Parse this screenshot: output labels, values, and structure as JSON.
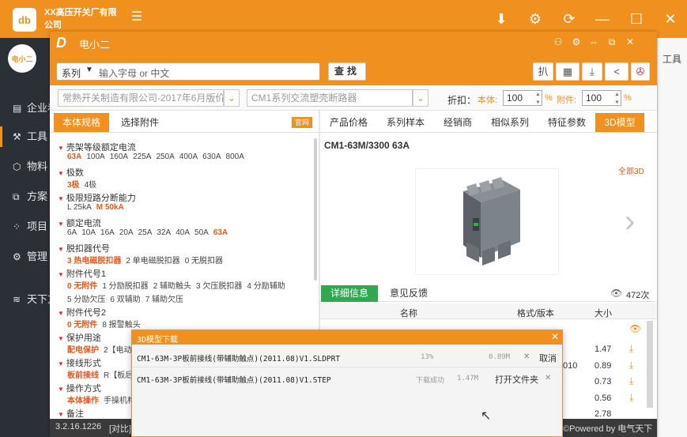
{
  "outer": {
    "logo": "db",
    "company": "XX高压开关厂有限公司",
    "menu_icon": "☰",
    "controls": [
      "⬇",
      "⚙",
      "⟳",
      "—",
      "☐",
      "✕"
    ],
    "sidebar": [
      {
        "icon": "▤",
        "label": "企业看"
      },
      {
        "icon": "⚒",
        "label": "工具"
      },
      {
        "icon": "⬡",
        "label": "物料"
      },
      {
        "icon": "⧉",
        "label": "方案"
      },
      {
        "icon": "⁘",
        "label": "项目"
      },
      {
        "icon": "⚙",
        "label": "管理"
      },
      {
        "icon": "≋",
        "label": "天下方"
      }
    ],
    "right_label": "工具"
  },
  "inner": {
    "app_name": "电小二",
    "logo": "D",
    "controls": [
      "⚇",
      "⚙",
      "⇔",
      "⧉",
      "✕"
    ]
  },
  "search": {
    "type": "系列",
    "placeholder": "输入字母 or 中文",
    "button": "查找",
    "tools": [
      "扒",
      "▦",
      "⤓",
      "<",
      "✇"
    ]
  },
  "filters": {
    "catalog": "常熟开关制造有限公司-2017年6月版价",
    "series": "CM1系列交流塑壳断路器",
    "discount_label": "折扣：",
    "ben_label": "本体:",
    "ben_value": "100",
    "fj_label": "附件:",
    "fj_value": "100",
    "pct": "%"
  },
  "left": {
    "tab_spec": "本体规格",
    "tab_acc": "选择附件",
    "official": "官网",
    "params": [
      {
        "title": "壳架等级额定电流",
        "opts": [
          {
            "t": "63A",
            "s": true
          },
          {
            "t": "100A"
          },
          {
            "t": "160A"
          },
          {
            "t": "225A"
          },
          {
            "t": "250A"
          },
          {
            "t": "400A"
          },
          {
            "t": "630A"
          },
          {
            "t": "800A"
          }
        ]
      },
      {
        "title": "极数",
        "opts": [
          {
            "t": "3极",
            "s": true
          },
          {
            "t": "4极"
          }
        ]
      },
      {
        "title": "极限短路分断能力",
        "opts": [
          {
            "t": "L 25kA"
          },
          {
            "t": "M 50kA",
            "s": true
          }
        ]
      },
      {
        "title": "额定电流",
        "opts": [
          {
            "t": "6A"
          },
          {
            "t": "10A"
          },
          {
            "t": "16A"
          },
          {
            "t": "20A"
          },
          {
            "t": "25A"
          },
          {
            "t": "32A"
          },
          {
            "t": "40A"
          },
          {
            "t": "50A"
          },
          {
            "t": "63A",
            "s": true
          }
        ]
      },
      {
        "title": "脱扣器代号",
        "opts": [
          {
            "t": "3 热电磁脱扣器",
            "s": true
          },
          {
            "t": "2 单电磁脱扣器"
          },
          {
            "t": "0 无脱扣器"
          }
        ]
      },
      {
        "title": "附件代号1",
        "opts": [
          {
            "t": "0 无附件",
            "s": true
          },
          {
            "t": "1 分励脱扣器"
          },
          {
            "t": "2 辅助触头"
          },
          {
            "t": "3 欠压脱扣器"
          },
          {
            "t": "4 分励辅助"
          }
        ]
      },
      {
        "title": "",
        "opts": [
          {
            "t": "5 分励欠压"
          },
          {
            "t": "6 双辅助"
          },
          {
            "t": "7 辅助欠压"
          }
        ]
      },
      {
        "title": "附件代号2",
        "opts": [
          {
            "t": "0 无附件",
            "s": true
          },
          {
            "t": "8 报警触头"
          }
        ]
      },
      {
        "title": "保护用途",
        "opts": [
          {
            "t": "配电保护",
            "s": true
          },
          {
            "t": "2【电动"
          }
        ]
      },
      {
        "title": "接线形式",
        "opts": [
          {
            "t": "板前接线",
            "s": true
          },
          {
            "t": "R【板后"
          }
        ]
      },
      {
        "title": "操作方式",
        "opts": [
          {
            "t": "本体操作",
            "s": true
          },
          {
            "t": "手操机构"
          }
        ]
      },
      {
        "title": "备注",
        "opts": []
      }
    ]
  },
  "right": {
    "tabs": [
      "产品价格",
      "系列样本",
      "经销商",
      "相似系列",
      "特征参数",
      "3D模型"
    ],
    "active_tab": 5,
    "product_code": "CM1-63M/3300 63A",
    "all_3d": "全部3D",
    "next": "›",
    "detail_tab": "详细信息",
    "feedback_tab": "意见反馈",
    "views": "472次",
    "columns": {
      "name": "名称",
      "format": "格式/版本",
      "size": "大小"
    },
    "sizes": [
      "1.47",
      "0.89",
      "0.73",
      "0.56",
      "2.78"
    ],
    "row_frag": "010"
  },
  "status": {
    "version": "3.2.16.1226",
    "frag": "[对比]",
    "powered": "©Powered by 电气天下"
  },
  "dialog": {
    "title": "3D模型下载",
    "close": "✕",
    "items": [
      {
        "name": "CM1-63M-3P板前接线(带辅助触点)(2011.08)V1.SLDPRT",
        "status": "13%",
        "size": "0.89M",
        "x": "✕",
        "action": "取消"
      },
      {
        "name": "CM1-63M-3P板前接线(带辅助触点)(2011.08)V1.STEP",
        "status": "下载成功",
        "size": "1.47M",
        "x": "✕",
        "action": "打开文件夹"
      }
    ]
  },
  "colors": {
    "accent": "#f0901e",
    "green": "#2fa84f",
    "sidebar": "#2b2f36"
  }
}
